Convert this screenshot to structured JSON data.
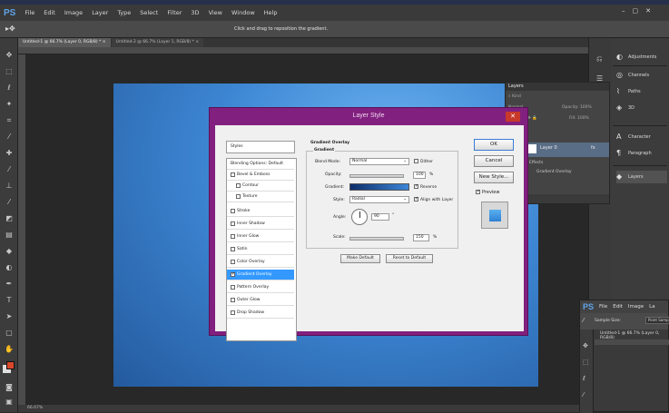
{
  "app": {
    "logo": "PS",
    "menu": [
      "File",
      "Edit",
      "Image",
      "Layer",
      "Type",
      "Select",
      "Filter",
      "3D",
      "View",
      "Window",
      "Help"
    ],
    "window_controls": [
      "–",
      "▢",
      "✕"
    ],
    "options_hint": "Click and drag to reposition the gradient.",
    "doc_tabs": [
      "Untitled-1 @ 66.7% (Layer 0, RGB/8) * ×",
      "Untitled-2 @ 66.7% (Layer 1, RGB/8) * ×"
    ],
    "status": "66.67%"
  },
  "right_panel": {
    "items": [
      {
        "icon": "adjustments-icon",
        "label": "Adjustments",
        "glyph": "◐"
      },
      {
        "icon": "channels-icon",
        "label": "Channels",
        "glyph": "◎"
      },
      {
        "icon": "paths-icon",
        "label": "Paths",
        "glyph": "⌇"
      },
      {
        "icon": "3d-icon",
        "label": "3D",
        "glyph": "◈"
      },
      {
        "icon": "character-icon",
        "label": "Character",
        "glyph": "A"
      },
      {
        "icon": "paragraph-icon",
        "label": "Paragraph",
        "glyph": "¶"
      },
      {
        "icon": "layers-icon",
        "label": "Layers",
        "glyph": "◆"
      }
    ]
  },
  "layers_panel": {
    "tab": "Layers",
    "kind_label": "Kind",
    "blend": "Normal",
    "opacity_label": "Opacity:",
    "opacity_value": "100%",
    "lock_label": "Lock:",
    "fill_label": "Fill:",
    "fill_value": "100%",
    "layer_name": "Layer 0",
    "fx": "fx",
    "effects_label": "Effects",
    "effect_item": "Gradient Overlay"
  },
  "dialog": {
    "title": "Layer Style",
    "close": "✕",
    "styles_header": "Styles",
    "styles": [
      {
        "label": "Blending Options: Default",
        "checkbox": false,
        "checked": false,
        "indent": false,
        "selected": false
      },
      {
        "label": "Bevel & Emboss",
        "checkbox": true,
        "checked": false,
        "indent": false,
        "selected": false
      },
      {
        "label": "Contour",
        "checkbox": true,
        "checked": false,
        "indent": true,
        "selected": false
      },
      {
        "label": "Texture",
        "checkbox": true,
        "checked": false,
        "indent": true,
        "selected": false
      },
      {
        "label": "Stroke",
        "checkbox": true,
        "checked": false,
        "indent": false,
        "selected": false
      },
      {
        "label": "Inner Shadow",
        "checkbox": true,
        "checked": false,
        "indent": false,
        "selected": false
      },
      {
        "label": "Inner Glow",
        "checkbox": true,
        "checked": false,
        "indent": false,
        "selected": false
      },
      {
        "label": "Satin",
        "checkbox": true,
        "checked": false,
        "indent": false,
        "selected": false
      },
      {
        "label": "Color Overlay",
        "checkbox": true,
        "checked": false,
        "indent": false,
        "selected": false
      },
      {
        "label": "Gradient Overlay",
        "checkbox": true,
        "checked": true,
        "indent": false,
        "selected": true
      },
      {
        "label": "Pattern Overlay",
        "checkbox": true,
        "checked": false,
        "indent": false,
        "selected": false
      },
      {
        "label": "Outer Glow",
        "checkbox": true,
        "checked": false,
        "indent": false,
        "selected": false
      },
      {
        "label": "Drop Shadow",
        "checkbox": true,
        "checked": false,
        "indent": false,
        "selected": false
      }
    ],
    "section_title": "Gradient Overlay",
    "subsection": "Gradient",
    "blend_mode_label": "Blend Mode:",
    "blend_mode_value": "Normal",
    "dither_label": "Dither",
    "opacity_label": "Opacity:",
    "opacity_value": "100",
    "opacity_unit": "%",
    "gradient_label": "Gradient:",
    "reverse_label": "Reverse",
    "style_label": "Style:",
    "style_value": "Radial",
    "align_label": "Align with Layer",
    "angle_label": "Angle:",
    "angle_value": "90",
    "angle_unit": "°",
    "scale_label": "Scale:",
    "scale_value": "150",
    "scale_unit": "%",
    "make_default": "Make Default",
    "reset_default": "Reset to Default",
    "ok": "OK",
    "cancel": "Cancel",
    "new_style": "New Style...",
    "preview_label": "Preview"
  },
  "inset": {
    "logo": "PS",
    "menu": [
      "File",
      "Edit",
      "Image",
      "La"
    ],
    "sample_label": "Sample Size:",
    "sample_value": "Point Sample",
    "tab": "Untitled-1 @ 66.7% (Layer 0, RGB/8)"
  }
}
